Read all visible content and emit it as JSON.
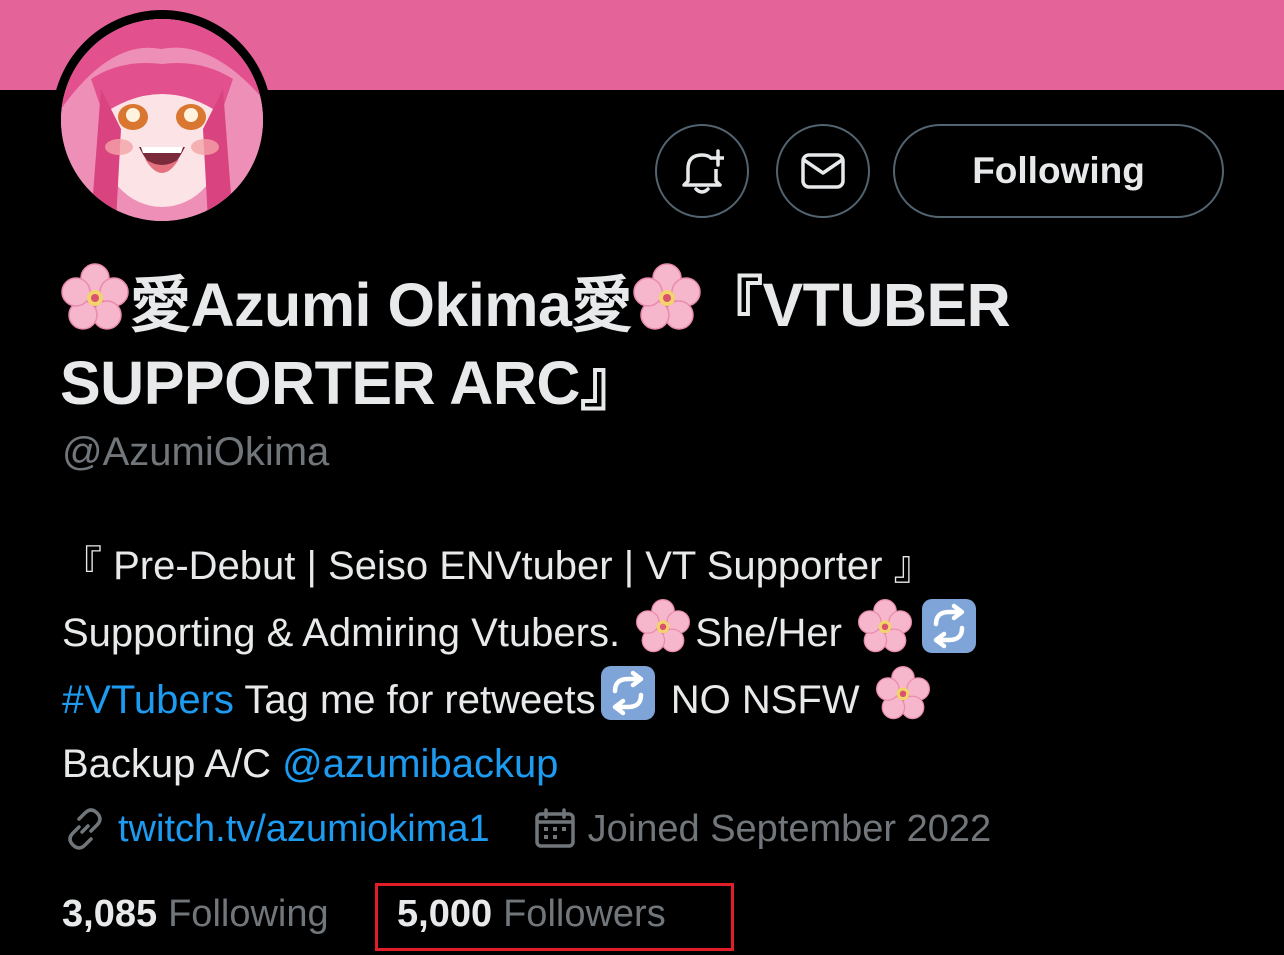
{
  "profile": {
    "display_name_part1": "愛Azumi Okima愛",
    "display_name_part2": "『VTUBER SUPPORTER ARC』",
    "handle": "@AzumiOkima"
  },
  "actions": {
    "notify_icon": "bell-plus-icon",
    "message_icon": "mail-icon",
    "follow_label": "Following"
  },
  "bio": {
    "line1": "『 Pre-Debut | Seiso ENVtuber | VT Supporter 』",
    "line2_a": "Supporting & Admiring Vtubers.",
    "line2_b": "She/Her",
    "hashtag": "#VTubers",
    "line3_a": "Tag me for retweets",
    "line3_b": "NO NSFW",
    "line4_a": "Backup A/C",
    "mention": "@azumibackup"
  },
  "meta": {
    "link_icon": "link-icon",
    "link_text": "twitch.tv/azumiokima1",
    "calendar_icon": "calendar-icon",
    "joined_text": "Joined September 2022"
  },
  "stats": {
    "following_count": "3,085",
    "following_label": "Following",
    "followers_count": "5,000",
    "followers_label": "Followers"
  },
  "colors": {
    "banner": "#e46399",
    "link": "#1d9bf0",
    "muted": "#71767b",
    "highlight_box": "#e11d2a"
  }
}
